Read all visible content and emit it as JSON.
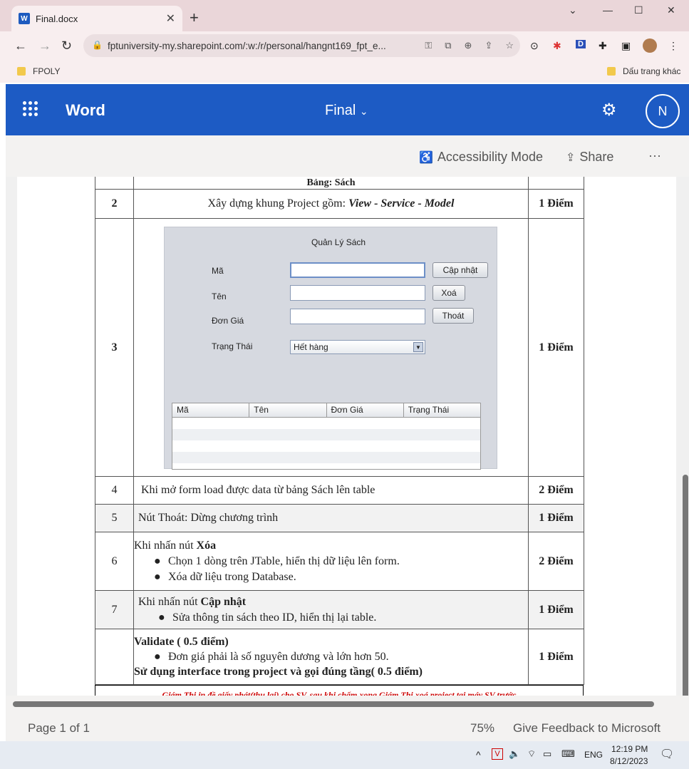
{
  "browser": {
    "tab_title": "Final.docx",
    "url": "fptuniversity-my.sharepoint.com/:w:/r/personal/hangnt169_fpt_e...",
    "bookmark_left": "FPOLY",
    "bookmark_right": "Dấu trang khác"
  },
  "word": {
    "app_name": "Word",
    "doc_name": "Final",
    "user_initial": "N",
    "accessibility_label": "Accessibility Mode",
    "share_label": "Share",
    "more_label": "···"
  },
  "doc": {
    "cut_text": "Bảng: Sách",
    "rows": [
      {
        "num": "2",
        "text_pre": "Xây dựng khung Project gồm: ",
        "text_em": "View - Service - Model",
        "points": "1 Điểm"
      },
      {
        "num": "3",
        "points": "1 Điểm"
      },
      {
        "num": "4",
        "text": "Khi mở form load được data từ bảng Sách lên table",
        "points": "2 Điểm"
      },
      {
        "num": "5",
        "text": "Nút Thoát: Dừng chương trình",
        "points": "1 Điểm"
      },
      {
        "num": "6",
        "head_pre": "Khi nhấn nút ",
        "head_b": "Xóa",
        "b1": "Chọn 1 dòng trên JTable, hiển thị dữ liệu lên form.",
        "b2": "Xóa dữ liệu trong Database.",
        "points": "2 Điểm"
      },
      {
        "num": "7",
        "head_pre": "Khi nhấn nút ",
        "head_b": "Cập nhật",
        "b1": "Sửa thông tin sách theo ID, hiển thị lại table.",
        "points": "1 Điểm"
      },
      {
        "num": "",
        "head_b": "Validate ( 0.5 điểm)",
        "b1": "Đơn giá phải là số nguyên dương và lớn hơn 50.",
        "tail_b": "Sử dụng interface trong project và gọi đúng tầng( 0.5 điểm)",
        "points": "1 Điểm"
      }
    ],
    "note": "Giám Thị in đề giấy phát(thu lại) cho SV, sau khi chấm xong Giám Thị xoá project tại máy SV trước"
  },
  "form": {
    "title": "Quản Lý Sách",
    "label_ma": "Mã",
    "label_ten": "Tên",
    "label_dongia": "Đơn Giá",
    "label_trangthai": "Trạng Thái",
    "btn_update": "Cập nhật",
    "btn_delete": "Xoá",
    "btn_exit": "Thoát",
    "status_value": "Hết hàng",
    "columns": [
      "Mã",
      "Tên",
      "Đơn Giá",
      "Trạng Thái"
    ]
  },
  "status": {
    "page": "Page 1 of 1",
    "zoom": "75%",
    "feedback": "Give Feedback to Microsoft"
  },
  "taskbar": {
    "lang": "ENG",
    "time": "12:19 PM",
    "date": "8/12/2023"
  }
}
